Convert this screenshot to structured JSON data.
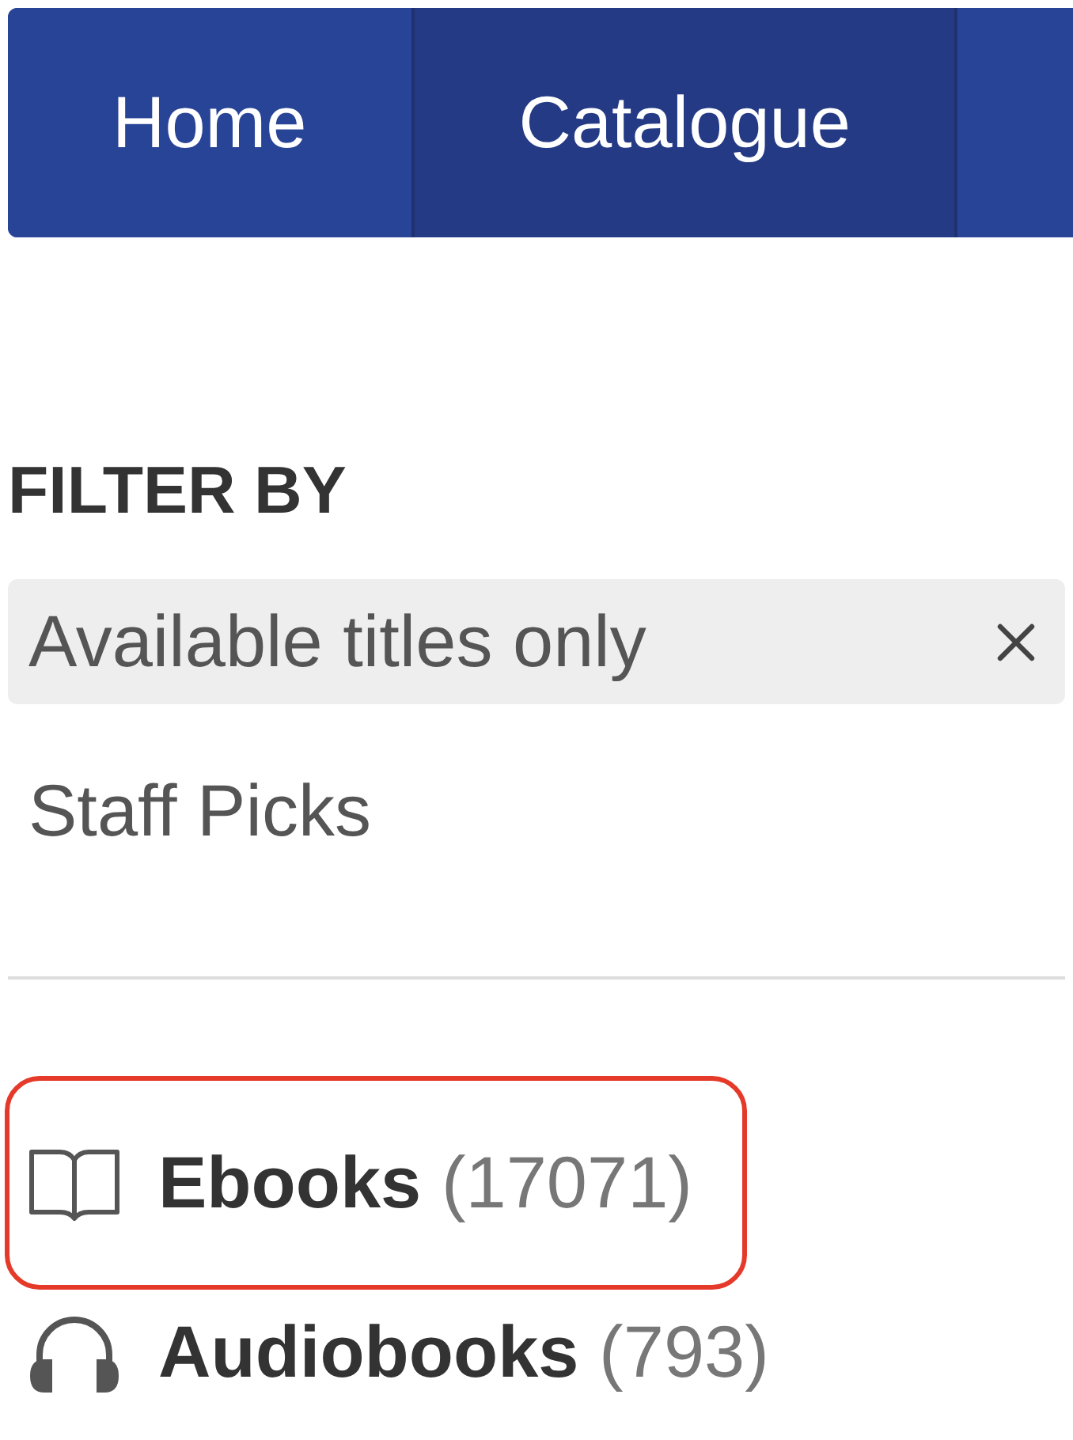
{
  "nav": {
    "tabs": [
      {
        "label": "Home",
        "selected": false
      },
      {
        "label": "Catalogue",
        "selected": true
      }
    ]
  },
  "filter_panel": {
    "heading": "FILTER BY",
    "filters": [
      {
        "label": "Available titles only",
        "applied": true
      },
      {
        "label": "Staff Picks",
        "applied": false
      }
    ]
  },
  "formats": [
    {
      "kind": "ebook",
      "label": "Ebooks",
      "count": "(17071)",
      "highlighted": true
    },
    {
      "kind": "audiobook",
      "label": "Audiobooks",
      "count": "(793)",
      "highlighted": false
    }
  ]
}
